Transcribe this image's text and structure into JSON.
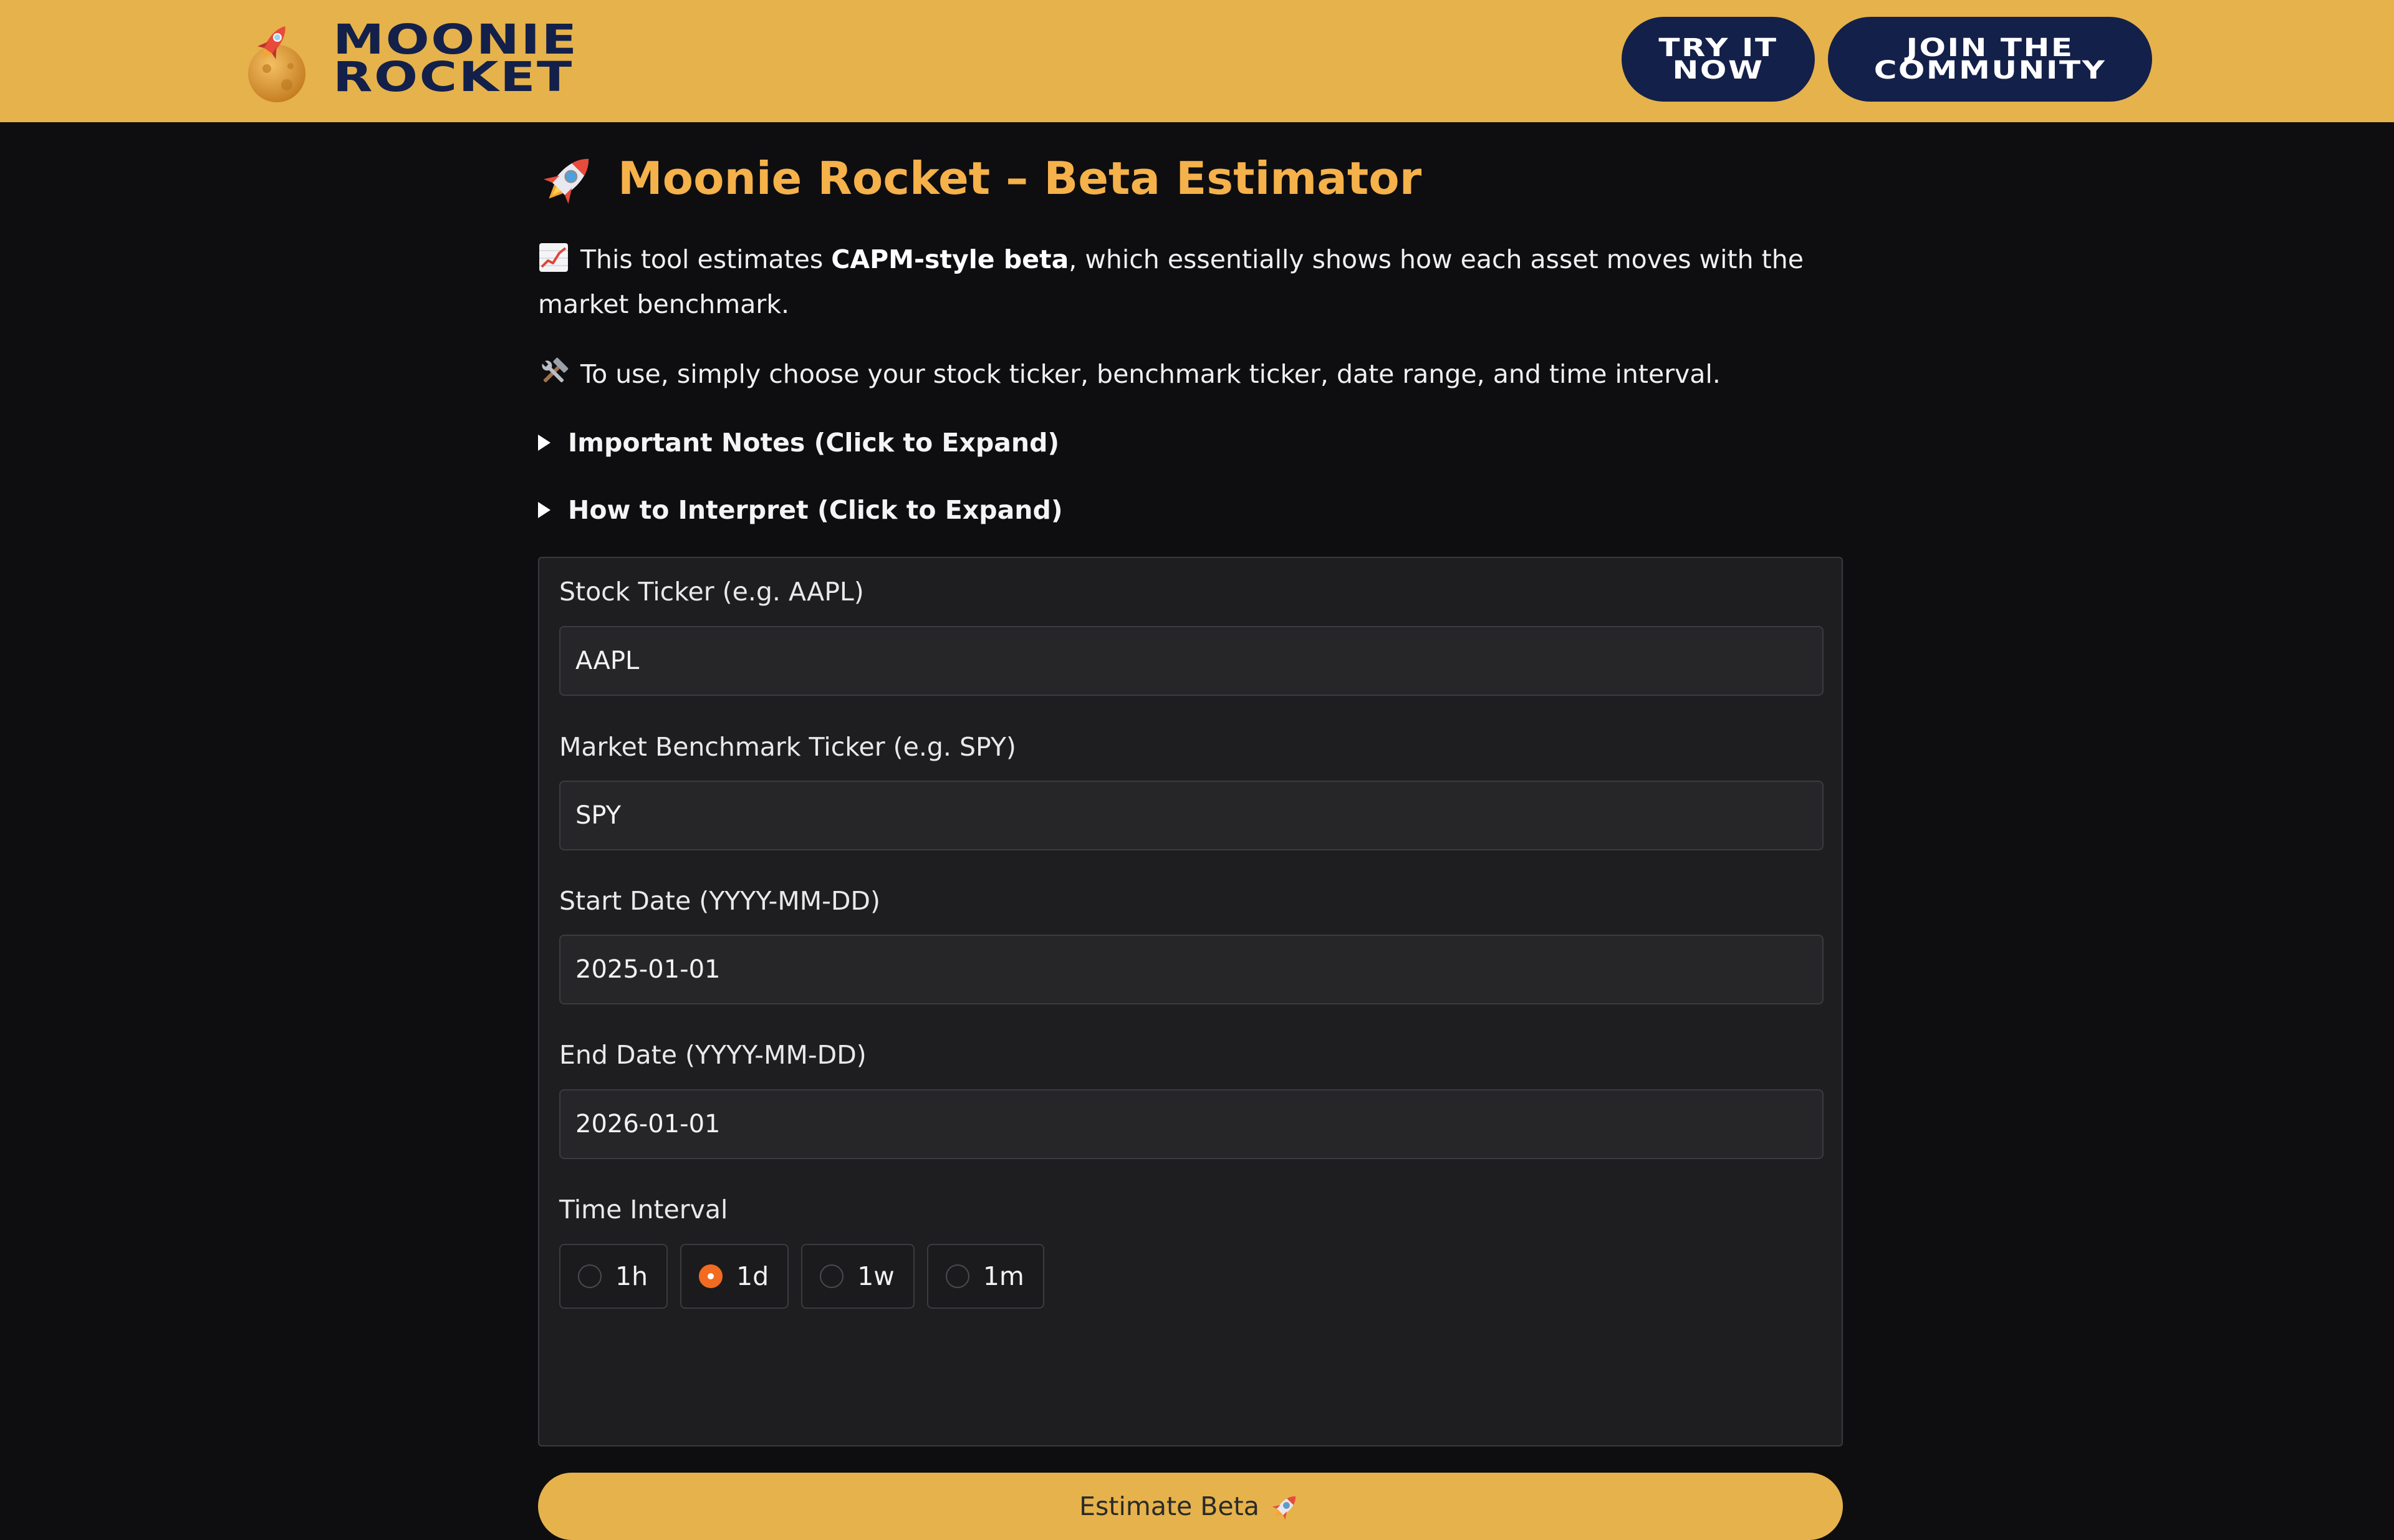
{
  "header": {
    "brand_line1": "MOONIE",
    "brand_line2": "ROCKET",
    "try_btn": "TRY IT NOW",
    "join_btn": "JOIN THE COMMUNITY",
    "colors": {
      "bar": "#e6b24b",
      "brand_text": "#13204a",
      "button_bg": "#13204a"
    }
  },
  "main": {
    "title": "Moonie Rocket – Beta Estimator",
    "title_icon": "rocket-icon",
    "intro": {
      "icon": "chart-increasing-icon",
      "prefix": "This tool estimates ",
      "bold": "CAPM-style beta",
      "suffix": ", which essentially shows how each asset moves with the market benchmark."
    },
    "usage": {
      "icon": "hammer-wrench-icon",
      "text": "To use, simply choose your stock ticker, benchmark ticker, date range, and time interval."
    },
    "expanders": [
      {
        "label": "Important Notes (Click to Expand)"
      },
      {
        "label": "How to Interpret (Click to Expand)"
      }
    ]
  },
  "form": {
    "stock": {
      "label": "Stock Ticker (e.g. AAPL)",
      "value": "AAPL"
    },
    "benchmark": {
      "label": "Market Benchmark Ticker (e.g. SPY)",
      "value": "SPY"
    },
    "start": {
      "label": "Start Date (YYYY-MM-DD)",
      "value": "2025-01-01"
    },
    "end": {
      "label": "End Date (YYYY-MM-DD)",
      "value": "2026-01-01"
    },
    "interval": {
      "label": "Time Interval",
      "options": [
        "1h",
        "1d",
        "1w",
        "1m"
      ],
      "selected": "1d"
    },
    "submit_label": "Estimate Beta"
  },
  "colors": {
    "accent": "#f5b14a",
    "radio_selected": "#f26b21",
    "page_bg": "#0e0e10",
    "card_bg": "#1e1e20"
  }
}
